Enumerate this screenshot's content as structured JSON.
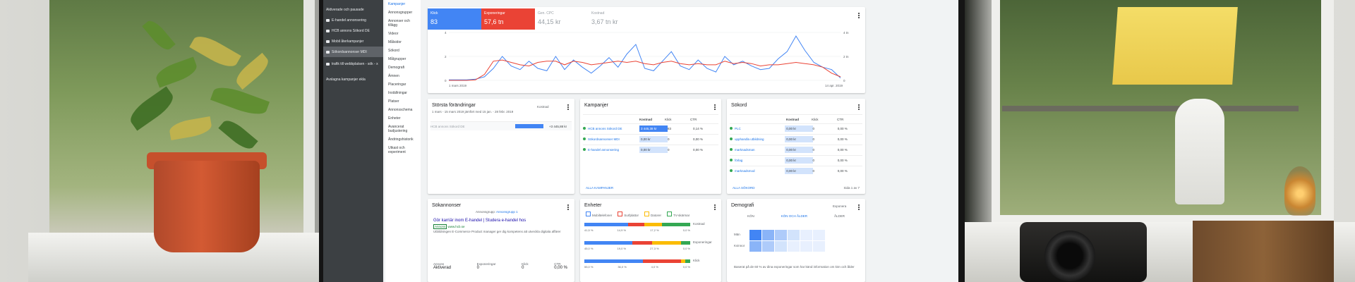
{
  "side_dark": {
    "header": "Aktiverade och pausade",
    "items": [
      {
        "label": "E-handel annonsering",
        "selected": false
      },
      {
        "label": "HCB annons Sökord DE",
        "selected": false
      },
      {
        "label": "Mobil återkampanjer",
        "selected": false
      },
      {
        "label": "Sökordsannonser MDI",
        "selected": true
      },
      {
        "label": "trafik till webbplatsen - sök - x",
        "selected": false
      }
    ],
    "footer": "Avslagna kampanjer ekla"
  },
  "side_nav": {
    "items": [
      "Kampanjer",
      "Annonsgrupper",
      "Annonser och tillägg",
      "Videor",
      "Målsidor",
      "Sökord",
      "Målgrupper",
      "Demografi",
      "Ämnen",
      "Placeringar",
      "Inställningar",
      "Platser",
      "Annonsschema",
      "Enheter",
      "Avancerat budjustering",
      "Ändringshistorik",
      "Utkast och experiment"
    ]
  },
  "metrics": [
    {
      "label": "Klick",
      "value": "83"
    },
    {
      "label": "Exponeringar",
      "value": "57,6 tn"
    },
    {
      "label": "Gen. CPC",
      "value": "44,15 kr"
    },
    {
      "label": "Kostnad",
      "value": "3,67 tn kr"
    }
  ],
  "chart_data": {
    "type": "line",
    "x_start_label": "1 mars 2019",
    "x_end_label": "14 apr. 2019",
    "y_left_ticks": [
      "4",
      "2",
      "0"
    ],
    "y_right_ticks": [
      "4 tn",
      "2 tn",
      "0"
    ],
    "ylim": [
      0,
      4
    ],
    "series": [
      {
        "name": "Klick",
        "color": "#4285f4",
        "values": [
          0.05,
          0.05,
          0.05,
          0.1,
          0.3,
          1.0,
          2.0,
          1.2,
          0.9,
          1.6,
          1.0,
          0.8,
          2.0,
          0.9,
          1.7,
          1.1,
          0.6,
          1.2,
          1.9,
          1.1,
          2.2,
          3.0,
          1.0,
          0.8,
          1.6,
          2.4,
          1.2,
          0.9,
          1.7,
          1.0,
          0.7,
          2.0,
          1.3,
          1.6,
          1.2,
          0.9,
          1.0,
          1.8,
          2.4,
          3.7,
          2.5,
          1.5,
          1.1,
          0.9,
          0.2
        ]
      },
      {
        "name": "Exponeringar",
        "color": "#ea4335",
        "values": [
          0.0,
          0.0,
          0.0,
          0.05,
          0.5,
          1.6,
          1.7,
          1.5,
          1.3,
          1.2,
          1.5,
          1.6,
          1.6,
          1.3,
          1.6,
          1.5,
          1.3,
          1.4,
          1.5,
          1.6,
          1.5,
          1.6,
          1.4,
          1.3,
          1.5,
          1.6,
          1.4,
          1.3,
          1.4,
          1.3,
          1.3,
          1.6,
          1.4,
          1.5,
          1.4,
          1.2,
          1.3,
          1.3,
          1.4,
          1.5,
          1.4,
          1.3,
          1.1,
          0.6,
          0.3
        ]
      }
    ]
  },
  "cards": {
    "changes": {
      "title": "Största förändringar",
      "subtitle": "1 mars - 15 mars 2019 jämfört med 15 jan. - 28 febr. 2019",
      "select": "Kostnad",
      "row_label": "HCB annons Sökord DE",
      "row_value": "+3 445,88 kr"
    },
    "campaigns": {
      "title": "Kampanjer",
      "cols": [
        "Kostnad",
        "Klick",
        "CTR"
      ],
      "rows": [
        {
          "name": "HCB annons Sökord DE",
          "cost": "3 445,38 kr",
          "clicks": "83",
          "ctr": "0,14 %"
        },
        {
          "name": "Sökordsannonser MDI",
          "cost": "0,00 kr",
          "clicks": "0",
          "ctr": "0,00 %"
        },
        {
          "name": "E-handel annonsering",
          "cost": "0,00 kr",
          "clicks": "0",
          "ctr": "0,00 %"
        }
      ],
      "link": "ALLA KAMPANJER"
    },
    "keywords": {
      "title": "Sökord",
      "cols": [
        "Kostnad",
        "Klick",
        "CTR"
      ],
      "rows": [
        {
          "name": "PLC",
          "cost": "0,00 kr",
          "clicks": "0",
          "ctr": "0,00 %"
        },
        {
          "name": "upphandla utbildning",
          "cost": "0,00 kr",
          "clicks": "0",
          "ctr": "0,00 %"
        },
        {
          "name": "marknadsman",
          "cost": "0,00 kr",
          "clicks": "0",
          "ctr": "0,00 %"
        },
        {
          "name": "förlag",
          "cost": "0,00 kr",
          "clicks": "0",
          "ctr": "0,00 %"
        },
        {
          "name": "marknadsmod",
          "cost": "0,00 kr",
          "clicks": "0",
          "ctr": "0,00 %"
        }
      ],
      "link": "ALLA SÖKORD",
      "pager": "Sida 1 av 7"
    },
    "ads": {
      "title": "Sökannonser",
      "group_label": "Annonsgrupp:",
      "group_value": "Annonsgrupp 1",
      "headline": "Gör karriär inom E-handel | Studera e-handel hos",
      "ad_badge": "Annons",
      "url": "www.hcb.se",
      "desc": "Utbildningen E-Commerce Product manager ger dig kompetens att utveckla digitala affärer",
      "stats": [
        {
          "label": "Annons",
          "value": "Aktiverad"
        },
        {
          "label": "Exponeringar",
          "value": "0"
        },
        {
          "label": "Klick",
          "value": "0"
        },
        {
          "label": "CTR",
          "value": "0,00 %"
        }
      ]
    },
    "devices": {
      "title": "Enheter",
      "legend": [
        "Mobiltelefoner",
        "Surfplattor",
        "Datorer",
        "TV-skärmar"
      ],
      "legend_colors": [
        "#4285f4",
        "#ea4335",
        "#fbbc04",
        "#34a853"
      ],
      "metrics": [
        {
          "label": "Kostnad",
          "parts": [
            0.415,
            0.149,
            0.172,
            0.264
          ],
          "texts": [
            "41,5 %",
            "14,9 %",
            "17,2 %",
            "0,0 %"
          ]
        },
        {
          "label": "Exponeringar",
          "parts": [
            0.45,
            0.19,
            0.273,
            0.087
          ],
          "texts": [
            "45,0 %",
            "19,0 %",
            "27,3 %",
            "0,0 %"
          ]
        },
        {
          "label": "Klick",
          "parts": [
            0.55,
            0.36,
            0.04,
            0.05
          ],
          "texts": [
            "55,0 %",
            "36,0 %",
            "4,0 %",
            "0,0 %"
          ]
        }
      ]
    },
    "demo": {
      "title": "Demografi",
      "select": "Exponera",
      "tabs": [
        "KÖN",
        "KÖN OCH ÅLDER",
        "ÅLDER"
      ],
      "rows": [
        "Män",
        "Kvinnor"
      ],
      "footnote": "Baserat på de 60 % av dina exponeringar som har känd information om kön och ålder"
    }
  }
}
